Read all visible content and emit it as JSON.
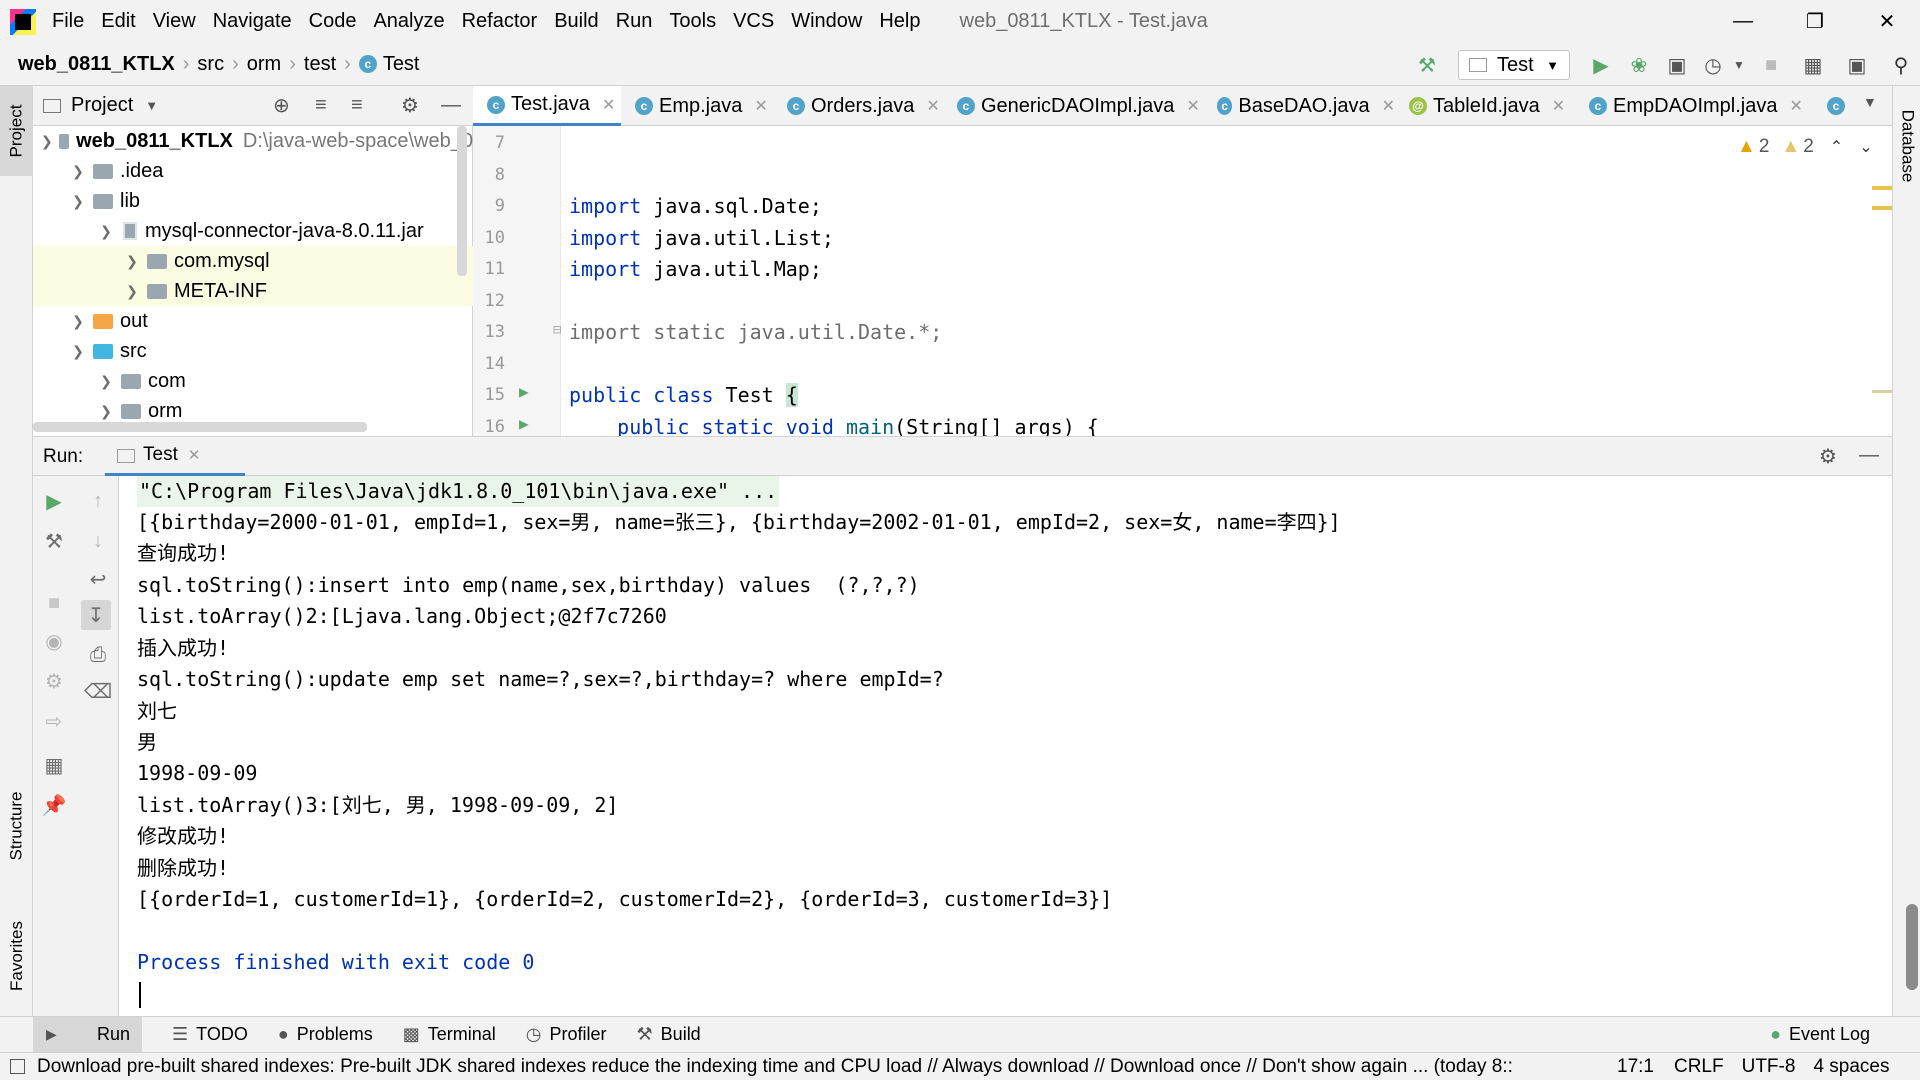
{
  "menubar": {
    "items": [
      "File",
      "Edit",
      "View",
      "Navigate",
      "Code",
      "Analyze",
      "Refactor",
      "Build",
      "Run",
      "Tools",
      "VCS",
      "Window",
      "Help"
    ],
    "window_title": "web_0811_KTLX - Test.java"
  },
  "navbar": {
    "project": "web_0811_KTLX",
    "crumbs": [
      "src",
      "orm",
      "test"
    ],
    "file": "Test",
    "run_config": "Test"
  },
  "project_panel": {
    "title": "Project",
    "tree": [
      {
        "name": "web_0811_KTLX",
        "path": "D:\\java-web-space\\web_0"
      },
      {
        "name": ".idea"
      },
      {
        "name": "lib"
      },
      {
        "name": "mysql-connector-java-8.0.11.jar"
      },
      {
        "name": "com.mysql"
      },
      {
        "name": "META-INF"
      },
      {
        "name": "out"
      },
      {
        "name": "src"
      },
      {
        "name": "com"
      },
      {
        "name": "orm"
      }
    ]
  },
  "editor_tabs": [
    {
      "label": "Test.java",
      "kind": "class"
    },
    {
      "label": "Emp.java",
      "kind": "class"
    },
    {
      "label": "Orders.java",
      "kind": "class"
    },
    {
      "label": "GenericDAOImpl.java",
      "kind": "class"
    },
    {
      "label": "BaseDAO.java",
      "kind": "class"
    },
    {
      "label": "TableId.java",
      "kind": "annotation"
    },
    {
      "label": "EmpDAOImpl.java",
      "kind": "class"
    }
  ],
  "editor": {
    "inspections": {
      "warnings": "2",
      "weak_warnings": "2"
    },
    "lines": [
      {
        "n": "7",
        "parts": []
      },
      {
        "n": "8",
        "parts": []
      },
      {
        "n": "9",
        "parts": [
          {
            "t": "import ",
            "c": "kw"
          },
          {
            "t": "java.sql.Date;",
            "c": ""
          }
        ]
      },
      {
        "n": "10",
        "parts": [
          {
            "t": "import ",
            "c": "kw"
          },
          {
            "t": "java.util.List;",
            "c": ""
          }
        ]
      },
      {
        "n": "11",
        "parts": [
          {
            "t": "import ",
            "c": "kw"
          },
          {
            "t": "java.util.Map;",
            "c": ""
          }
        ]
      },
      {
        "n": "12",
        "parts": []
      },
      {
        "n": "13",
        "parts": [
          {
            "t": "import static java.util.Date.*;",
            "c": "grey"
          }
        ]
      },
      {
        "n": "14",
        "parts": []
      },
      {
        "n": "15",
        "parts": [
          {
            "t": "public class ",
            "c": "kw"
          },
          {
            "t": "Test ",
            "c": ""
          },
          {
            "t": "{",
            "c": ""
          }
        ]
      },
      {
        "n": "16",
        "parts": [
          {
            "t": "    public static void ",
            "c": "kw"
          },
          {
            "t": "main",
            "c": "fn"
          },
          {
            "t": "(String[] args) {",
            "c": ""
          }
        ]
      }
    ]
  },
  "run_panel": {
    "label": "Run:",
    "tab": "Test",
    "console": [
      {
        "text": "\"C:\\Program Files\\Java\\jdk1.8.0_101\\bin\\java.exe\" ...",
        "style": "cmd"
      },
      {
        "text": "[{birthday=2000-01-01, empId=1, sex=男, name=张三}, {birthday=2002-01-01, empId=2, sex=女, name=李四}]",
        "style": ""
      },
      {
        "text": "查询成功!",
        "style": ""
      },
      {
        "text": "sql.toString():insert into emp(name,sex,birthday) values  (?,?,?)",
        "style": ""
      },
      {
        "text": "list.toArray()2:[Ljava.lang.Object;@2f7c7260",
        "style": ""
      },
      {
        "text": "插入成功!",
        "style": ""
      },
      {
        "text": "sql.toString():update emp set name=?,sex=?,birthday=? where empId=?",
        "style": ""
      },
      {
        "text": "刘七",
        "style": ""
      },
      {
        "text": "男",
        "style": ""
      },
      {
        "text": "1998-09-09",
        "style": ""
      },
      {
        "text": "list.toArray()3:[刘七, 男, 1998-09-09, 2]",
        "style": ""
      },
      {
        "text": "修改成功!",
        "style": ""
      },
      {
        "text": "删除成功!",
        "style": ""
      },
      {
        "text": "[{orderId=1, customerId=1}, {orderId=2, customerId=2}, {orderId=3, customerId=3}]",
        "style": ""
      },
      {
        "text": "",
        "style": ""
      },
      {
        "text": "Process finished with exit code 0",
        "style": "blue"
      }
    ]
  },
  "side_tabs": {
    "project": "Project",
    "structure": "Structure",
    "favorites": "Favorites",
    "database": "Database"
  },
  "bottom_tabs": [
    "Run",
    "TODO",
    "Problems",
    "Terminal",
    "Profiler",
    "Build"
  ],
  "event_log": "Event Log",
  "status": {
    "message": "Download pre-built shared indexes: Pre-built JDK shared indexes reduce the indexing time and CPU load // Always download // Download once // Don't show again ... (today 8::",
    "position": "17:1",
    "line_sep": "CRLF",
    "encoding": "UTF-8",
    "indent": "4 spaces"
  }
}
